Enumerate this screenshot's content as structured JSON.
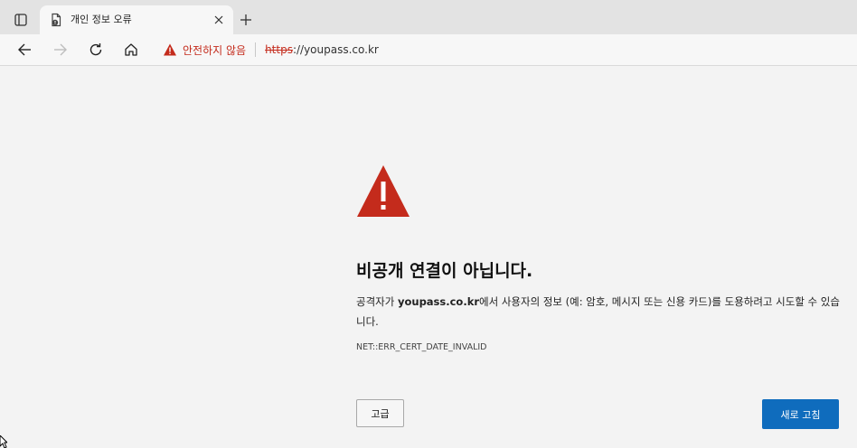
{
  "tab": {
    "title": "개인 정보 오류"
  },
  "toolbar": {
    "security_warning": "안전하지 않음",
    "url_scheme": "https",
    "url_rest": "://youpass.co.kr"
  },
  "page": {
    "heading": "비공개 연결이 아닙니다.",
    "description_prefix": "공격자가 ",
    "description_domain": "youpass.co.kr",
    "description_suffix": "에서 사용자의 정보 (예: 암호, 메시지 또는 신용 카드)를 도용하려고 시도할 수 있습니다.",
    "error_code": "NET::ERR_CERT_DATE_INVALID",
    "advanced_label": "고급",
    "reload_label": "새로 고침"
  },
  "colors": {
    "warning_red": "#c42b1c",
    "primary_button": "#0f6cbd"
  },
  "icons": {
    "tab_actions": "tab-actions-icon",
    "favicon": "document-warning-icon",
    "close": "close-icon",
    "new_tab": "plus-icon",
    "back": "back-arrow-icon",
    "forward": "forward-arrow-icon",
    "refresh": "refresh-icon",
    "home": "home-icon",
    "warning": "warning-triangle-icon"
  }
}
